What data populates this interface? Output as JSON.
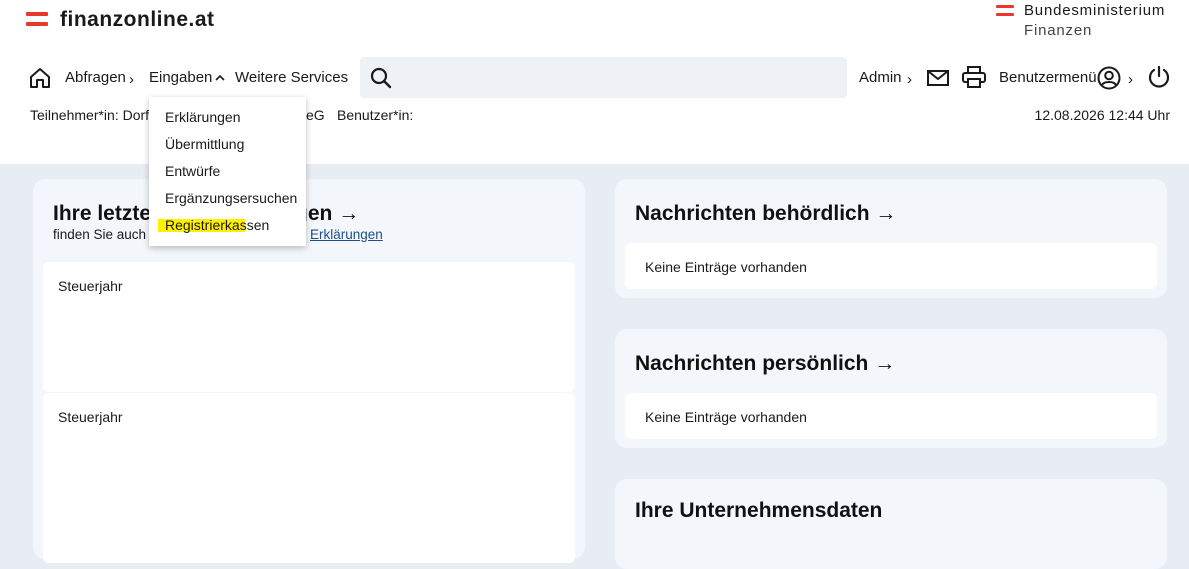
{
  "header": {
    "logo_text": "finanzonline.at",
    "ministry_line1": "Bundesministerium",
    "ministry_line2": "Finanzen",
    "brand_color": "#e6392c"
  },
  "nav": {
    "abfragen": "Abfragen",
    "eingaben": "Eingaben",
    "weitere": "Weitere Services",
    "admin": "Admin",
    "benutzermenu": "Benutzermenü",
    "search_placeholder": ""
  },
  "info": {
    "teilnehmer": "Teilnehmer*in: Dorf",
    "teilnehmer_tail": "eG",
    "benutzer": "Benutzer*in:",
    "datetime": "12.08.2026 12:44 Uhr"
  },
  "dropdown": {
    "items": [
      "Erklärungen",
      "Übermittlung",
      "Entwürfe",
      "Ergänzungsersuchen",
      "Registrierkassen"
    ]
  },
  "left_card": {
    "title_start": "Ihre letzte",
    "title_end": "gen",
    "sub_start": "finden Sie auch",
    "sub_link": "Erklärungen",
    "year1": "Steuerjahr",
    "year2": "Steuerjahr"
  },
  "cards": {
    "behordlich_title": "Nachrichten behördlich",
    "behordlich_empty": "Keine Einträge vorhanden",
    "personlich_title": "Nachrichten persönlich",
    "personlich_empty": "Keine Einträge vorhanden",
    "unternehmen_title": "Ihre Unternehmensdaten"
  },
  "arrow": "→"
}
